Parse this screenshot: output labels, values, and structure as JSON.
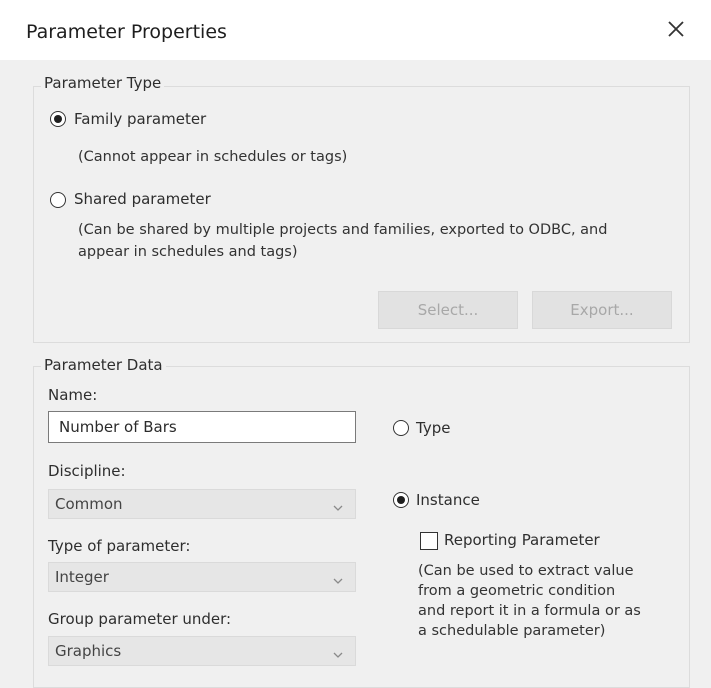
{
  "window": {
    "title": "Parameter Properties"
  },
  "parameter_type": {
    "heading": "Parameter Type",
    "family_label": "Family parameter",
    "family_hint": "(Cannot appear in schedules or tags)",
    "shared_label": "Shared parameter",
    "shared_hint_line1": "(Can be shared by multiple projects and families, exported to ODBC, and",
    "shared_hint_line2": "appear in schedules and tags)",
    "selected": "Family parameter",
    "select_button": "Select...",
    "export_button": "Export..."
  },
  "parameter_data": {
    "heading": "Parameter Data",
    "name_label": "Name:",
    "name_value": "Number of Bars",
    "discipline_label": "Discipline:",
    "discipline_value": "Common",
    "type_of_parameter_label": "Type of parameter:",
    "type_of_parameter_value": "Integer",
    "group_label": "Group parameter under:",
    "group_value": "Graphics",
    "type_radio_label": "Type",
    "instance_radio_label": "Instance",
    "selected_scope": "Instance",
    "reporting_label": "Reporting Parameter",
    "reporting_checked": false,
    "reporting_hint_line1": "(Can be used to extract value",
    "reporting_hint_line2": "from a geometric condition",
    "reporting_hint_line3": "and report it in a formula or as",
    "reporting_hint_line4": "a schedulable parameter)"
  }
}
